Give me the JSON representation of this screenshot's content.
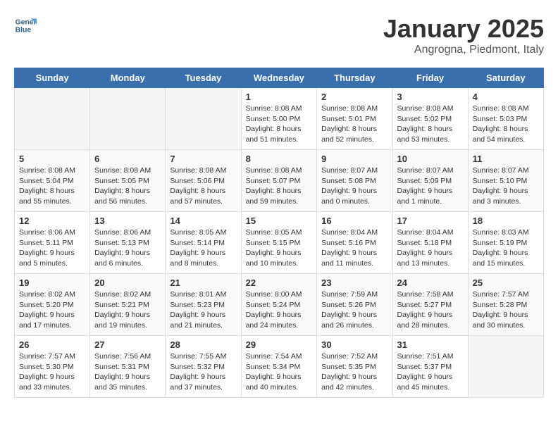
{
  "header": {
    "logo_line1": "General",
    "logo_line2": "Blue",
    "month": "January 2025",
    "location": "Angrogna, Piedmont, Italy"
  },
  "weekdays": [
    "Sunday",
    "Monday",
    "Tuesday",
    "Wednesday",
    "Thursday",
    "Friday",
    "Saturday"
  ],
  "weeks": [
    [
      {
        "day": "",
        "info": ""
      },
      {
        "day": "",
        "info": ""
      },
      {
        "day": "",
        "info": ""
      },
      {
        "day": "1",
        "info": "Sunrise: 8:08 AM\nSunset: 5:00 PM\nDaylight: 8 hours and 51 minutes."
      },
      {
        "day": "2",
        "info": "Sunrise: 8:08 AM\nSunset: 5:01 PM\nDaylight: 8 hours and 52 minutes."
      },
      {
        "day": "3",
        "info": "Sunrise: 8:08 AM\nSunset: 5:02 PM\nDaylight: 8 hours and 53 minutes."
      },
      {
        "day": "4",
        "info": "Sunrise: 8:08 AM\nSunset: 5:03 PM\nDaylight: 8 hours and 54 minutes."
      }
    ],
    [
      {
        "day": "5",
        "info": "Sunrise: 8:08 AM\nSunset: 5:04 PM\nDaylight: 8 hours and 55 minutes."
      },
      {
        "day": "6",
        "info": "Sunrise: 8:08 AM\nSunset: 5:05 PM\nDaylight: 8 hours and 56 minutes."
      },
      {
        "day": "7",
        "info": "Sunrise: 8:08 AM\nSunset: 5:06 PM\nDaylight: 8 hours and 57 minutes."
      },
      {
        "day": "8",
        "info": "Sunrise: 8:08 AM\nSunset: 5:07 PM\nDaylight: 8 hours and 59 minutes."
      },
      {
        "day": "9",
        "info": "Sunrise: 8:07 AM\nSunset: 5:08 PM\nDaylight: 9 hours and 0 minutes."
      },
      {
        "day": "10",
        "info": "Sunrise: 8:07 AM\nSunset: 5:09 PM\nDaylight: 9 hours and 1 minute."
      },
      {
        "day": "11",
        "info": "Sunrise: 8:07 AM\nSunset: 5:10 PM\nDaylight: 9 hours and 3 minutes."
      }
    ],
    [
      {
        "day": "12",
        "info": "Sunrise: 8:06 AM\nSunset: 5:11 PM\nDaylight: 9 hours and 5 minutes."
      },
      {
        "day": "13",
        "info": "Sunrise: 8:06 AM\nSunset: 5:13 PM\nDaylight: 9 hours and 6 minutes."
      },
      {
        "day": "14",
        "info": "Sunrise: 8:05 AM\nSunset: 5:14 PM\nDaylight: 9 hours and 8 minutes."
      },
      {
        "day": "15",
        "info": "Sunrise: 8:05 AM\nSunset: 5:15 PM\nDaylight: 9 hours and 10 minutes."
      },
      {
        "day": "16",
        "info": "Sunrise: 8:04 AM\nSunset: 5:16 PM\nDaylight: 9 hours and 11 minutes."
      },
      {
        "day": "17",
        "info": "Sunrise: 8:04 AM\nSunset: 5:18 PM\nDaylight: 9 hours and 13 minutes."
      },
      {
        "day": "18",
        "info": "Sunrise: 8:03 AM\nSunset: 5:19 PM\nDaylight: 9 hours and 15 minutes."
      }
    ],
    [
      {
        "day": "19",
        "info": "Sunrise: 8:02 AM\nSunset: 5:20 PM\nDaylight: 9 hours and 17 minutes."
      },
      {
        "day": "20",
        "info": "Sunrise: 8:02 AM\nSunset: 5:21 PM\nDaylight: 9 hours and 19 minutes."
      },
      {
        "day": "21",
        "info": "Sunrise: 8:01 AM\nSunset: 5:23 PM\nDaylight: 9 hours and 21 minutes."
      },
      {
        "day": "22",
        "info": "Sunrise: 8:00 AM\nSunset: 5:24 PM\nDaylight: 9 hours and 24 minutes."
      },
      {
        "day": "23",
        "info": "Sunrise: 7:59 AM\nSunset: 5:26 PM\nDaylight: 9 hours and 26 minutes."
      },
      {
        "day": "24",
        "info": "Sunrise: 7:58 AM\nSunset: 5:27 PM\nDaylight: 9 hours and 28 minutes."
      },
      {
        "day": "25",
        "info": "Sunrise: 7:57 AM\nSunset: 5:28 PM\nDaylight: 9 hours and 30 minutes."
      }
    ],
    [
      {
        "day": "26",
        "info": "Sunrise: 7:57 AM\nSunset: 5:30 PM\nDaylight: 9 hours and 33 minutes."
      },
      {
        "day": "27",
        "info": "Sunrise: 7:56 AM\nSunset: 5:31 PM\nDaylight: 9 hours and 35 minutes."
      },
      {
        "day": "28",
        "info": "Sunrise: 7:55 AM\nSunset: 5:32 PM\nDaylight: 9 hours and 37 minutes."
      },
      {
        "day": "29",
        "info": "Sunrise: 7:54 AM\nSunset: 5:34 PM\nDaylight: 9 hours and 40 minutes."
      },
      {
        "day": "30",
        "info": "Sunrise: 7:52 AM\nSunset: 5:35 PM\nDaylight: 9 hours and 42 minutes."
      },
      {
        "day": "31",
        "info": "Sunrise: 7:51 AM\nSunset: 5:37 PM\nDaylight: 9 hours and 45 minutes."
      },
      {
        "day": "",
        "info": ""
      }
    ]
  ]
}
